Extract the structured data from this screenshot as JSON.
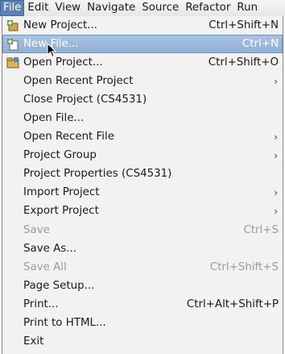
{
  "menubar": [
    "File",
    "Edit",
    "View",
    "Navigate",
    "Source",
    "Refactor",
    "Run"
  ],
  "menu": [
    {
      "label": "New Project...",
      "accel": "Ctrl+Shift+N",
      "icon": "new-project-icon"
    },
    {
      "label": "New File...",
      "accel": "Ctrl+N",
      "icon": "new-file-icon",
      "highlight": true
    },
    {
      "label": "Open Project...",
      "accel": "Ctrl+Shift+O",
      "icon": "open-project-icon"
    },
    {
      "label": "Open Recent Project",
      "submenu": true
    },
    {
      "label": "Close Project (CS4531)"
    },
    {
      "label": "Open File..."
    },
    {
      "label": "Open Recent File",
      "submenu": true
    },
    {
      "label": "Project Group",
      "submenu": true
    },
    {
      "label": "Project Properties (CS4531)"
    },
    {
      "label": "Import Project",
      "submenu": true
    },
    {
      "label": "Export Project",
      "submenu": true
    },
    {
      "label": "Save",
      "accel": "Ctrl+S",
      "disabled": true
    },
    {
      "label": "Save As..."
    },
    {
      "label": "Save All",
      "accel": "Ctrl+Shift+S",
      "disabled": true
    },
    {
      "label": "Page Setup..."
    },
    {
      "label": "Print...",
      "accel": "Ctrl+Alt+Shift+P"
    },
    {
      "label": "Print to HTML..."
    },
    {
      "label": "Exit"
    }
  ],
  "icons": {
    "arrow": "›"
  },
  "colors": {
    "highlight": "#8fb0d8",
    "active_menu": "#5b83b3",
    "disabled": "#9a9a9a"
  }
}
